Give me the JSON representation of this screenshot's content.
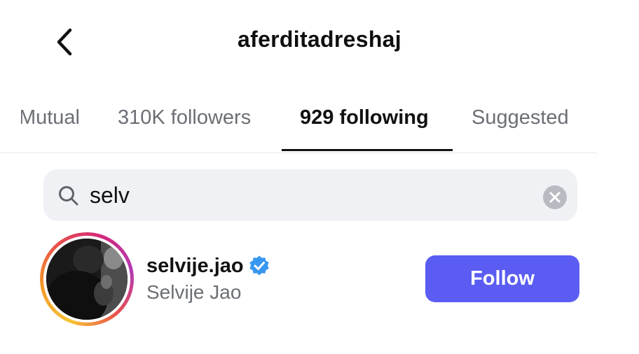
{
  "header": {
    "title": "aferditadreshaj",
    "back_icon": "chevron-left-icon"
  },
  "tabs": [
    {
      "label": "Mutual",
      "active": false
    },
    {
      "label": "310K followers",
      "active": false
    },
    {
      "label": "929 following",
      "active": true
    },
    {
      "label": "Suggested",
      "active": false
    }
  ],
  "search": {
    "icon": "search-icon",
    "value": "selv",
    "clear_icon": "clear-icon"
  },
  "results": [
    {
      "username": "selvije.jao",
      "full_name": "Selvije Jao",
      "verified": true,
      "has_story_ring": true,
      "button_label": "Follow"
    }
  ],
  "colors": {
    "follow_button": "#5b5df2",
    "verified_badge": "#3897f0",
    "search_background": "#eff1f4"
  }
}
